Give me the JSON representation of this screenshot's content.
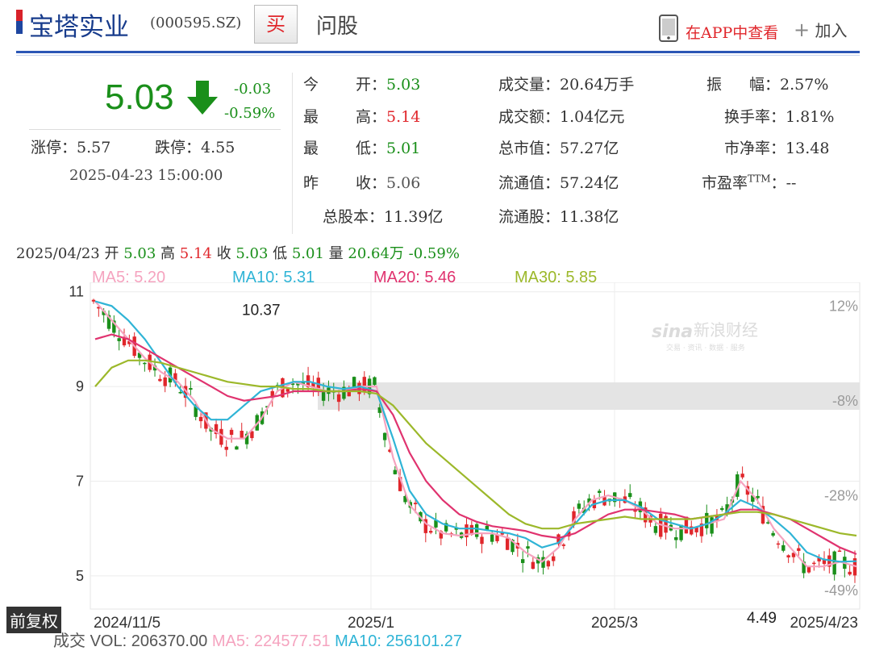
{
  "header": {
    "name": "宝塔实业",
    "code": "(000595.SZ)",
    "buy_label": "买",
    "ask_label": "问股",
    "app_label": "在APP中查看",
    "add_label": "加入"
  },
  "quote": {
    "price": "5.03",
    "change": "-0.03",
    "change_pct": "-0.59%",
    "limit_up_label": "涨停：",
    "limit_up": "5.57",
    "limit_down_label": "跌停：",
    "limit_down": "4.55",
    "time": "2025-04-23 15:00:00"
  },
  "stats": [
    {
      "l1": "今",
      "l2": "开：",
      "v": "5.03",
      "color": "green"
    },
    {
      "l1": "最",
      "l2": "高：",
      "v": "5.14",
      "color": "red"
    },
    {
      "l1": "最",
      "l2": "低：",
      "v": "5.01",
      "color": "green"
    },
    {
      "l1": "昨",
      "l2": "收：",
      "v": "5.06",
      "color": "grey"
    }
  ],
  "total_shares": {
    "label": "总股本：",
    "value": "11.39亿"
  },
  "stats2": [
    {
      "label": "成交量：",
      "value": "20.64万手"
    },
    {
      "label": "成交额：",
      "value": "1.04亿元"
    },
    {
      "label": "总市值：",
      "value": "57.27亿"
    },
    {
      "label": "流通值：",
      "value": "57.24亿"
    },
    {
      "label": "流通股：",
      "value": "11.38亿"
    }
  ],
  "stats3": [
    {
      "label": "振",
      "label2": "幅：",
      "value": "2.57%"
    },
    {
      "label": "换手率：",
      "value": "1.81%"
    },
    {
      "label": "市净率：",
      "value": "13.48"
    },
    {
      "label": "市盈率",
      "sup": "TTM",
      "label2": "：",
      "value": "--"
    }
  ],
  "summary": {
    "date": "2025/04/23",
    "open_label": "开",
    "open": "5.03",
    "high_label": "高",
    "high": "5.14",
    "close_label": "收",
    "close": "5.03",
    "low_label": "低",
    "low": "5.01",
    "vol_label": "量",
    "vol": "20.64万",
    "pct": "-0.59%"
  },
  "ma": [
    {
      "text": "MA5: 5.20",
      "color": "#f5a3bf"
    },
    {
      "text": "MA10: 5.31",
      "color": "#2fb4d6"
    },
    {
      "text": "MA20: 5.46",
      "color": "#e0336f"
    },
    {
      "text": "MA30: 5.85",
      "color": "#9cb82a"
    }
  ],
  "fq_label": "前复权",
  "volume": {
    "label": "成交",
    "vol": "VOL: 206370.00",
    "ma5": "MA5: 224577.51",
    "ma10": "MA10: 256101.27"
  },
  "colors": {
    "up": "#e0262b",
    "down": "#1a8f1a",
    "accent": "#2b56b5"
  },
  "chart_data": {
    "type": "candlestick",
    "x_ticks": [
      "2024/11/5",
      "2025/1",
      "2025/3",
      "2025/4/23"
    ],
    "y_ticks": [
      "11",
      "9",
      "7",
      "5"
    ],
    "y_ticks_right": [
      "12%",
      "-8%",
      "-28%",
      "-49%"
    ],
    "ylim": [
      4.3,
      11.2
    ],
    "annotations": [
      {
        "text": "10.37",
        "value": 10.37
      },
      {
        "text": "4.49",
        "value": 4.49
      }
    ],
    "series": [
      {
        "name": "MA5",
        "values": [
          10.8,
          10.4,
          10.0,
          9.6,
          9.3,
          9.1,
          8.7,
          8.1,
          7.9,
          7.9,
          8.3,
          8.9,
          9.1,
          9.0,
          8.9,
          8.9,
          9.0,
          9.0,
          7.5,
          6.5,
          6.1,
          5.9,
          5.85,
          5.9,
          5.9,
          5.8,
          5.5,
          5.3,
          5.6,
          6.2,
          6.6,
          6.7,
          6.6,
          6.4,
          6.1,
          6.0,
          6.0,
          6.1,
          6.2,
          7.0,
          6.6,
          6.0,
          5.6,
          5.2,
          5.2,
          5.3,
          5.2
        ]
      },
      {
        "name": "MA10",
        "values": [
          10.8,
          10.7,
          10.4,
          10.0,
          9.5,
          9.0,
          8.6,
          8.3,
          8.3,
          8.6,
          8.9,
          9.0,
          9.1,
          9.1,
          9.0,
          8.95,
          9.0,
          8.9,
          7.9,
          6.8,
          6.3,
          6.1,
          6.0,
          6.0,
          5.95,
          5.9,
          5.8,
          5.6,
          5.7,
          6.1,
          6.5,
          6.6,
          6.6,
          6.45,
          6.2,
          6.1,
          6.0,
          6.1,
          6.3,
          6.6,
          6.45,
          6.2,
          5.9,
          5.5,
          5.35,
          5.3,
          5.31
        ]
      },
      {
        "name": "MA20",
        "values": [
          10.0,
          10.1,
          10.0,
          9.8,
          9.6,
          9.4,
          9.2,
          9.0,
          8.8,
          8.7,
          8.75,
          8.8,
          8.9,
          8.9,
          8.9,
          8.9,
          8.95,
          8.9,
          8.4,
          7.6,
          7.0,
          6.6,
          6.3,
          6.15,
          6.05,
          6.0,
          5.95,
          5.85,
          5.8,
          5.9,
          6.1,
          6.3,
          6.4,
          6.4,
          6.35,
          6.3,
          6.2,
          6.25,
          6.3,
          6.4,
          6.4,
          6.3,
          6.2,
          6.0,
          5.8,
          5.6,
          5.46
        ]
      },
      {
        "name": "MA30",
        "values": [
          9.0,
          9.4,
          9.55,
          9.55,
          9.5,
          9.4,
          9.3,
          9.2,
          9.1,
          9.05,
          9.0,
          9.0,
          8.95,
          8.95,
          8.9,
          8.9,
          8.9,
          8.85,
          8.6,
          8.2,
          7.8,
          7.5,
          7.2,
          6.9,
          6.6,
          6.3,
          6.1,
          6.0,
          6.0,
          6.1,
          6.15,
          6.2,
          6.25,
          6.2,
          6.2,
          6.2,
          6.2,
          6.25,
          6.3,
          6.35,
          6.35,
          6.3,
          6.2,
          6.1,
          6.0,
          5.9,
          5.85
        ]
      }
    ]
  }
}
